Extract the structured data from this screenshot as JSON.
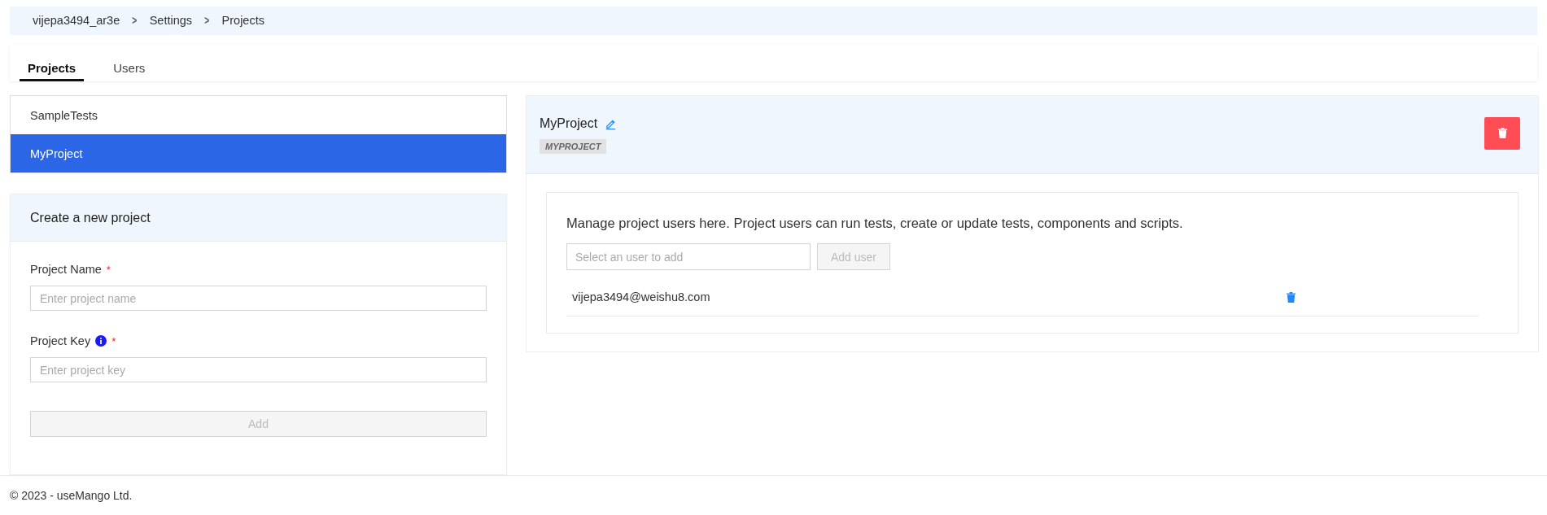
{
  "breadcrumb": [
    "vijepa3494_ar3e",
    "Settings",
    "Projects"
  ],
  "breadcrumb_separator": ">",
  "tabs": [
    {
      "label": "Projects",
      "selected": true
    },
    {
      "label": "Users",
      "selected": false
    }
  ],
  "projects": [
    {
      "name": "SampleTests",
      "selected": false
    },
    {
      "name": "MyProject",
      "selected": true
    }
  ],
  "create_form": {
    "title": "Create a new project",
    "fields": [
      {
        "label": "Project Name",
        "required": true,
        "info": false,
        "placeholder": "Enter project name"
      },
      {
        "label": "Project Key",
        "required": true,
        "info": true,
        "placeholder": "Enter project key"
      }
    ],
    "required_mark": "*",
    "submit": {
      "label": "Add",
      "disabled": true
    }
  },
  "project_detail": {
    "name": "MyProject",
    "key": "MYPROJECT",
    "description": "Manage project users here. Project users can run tests, create or update tests, components and scripts.",
    "user_select": {
      "placeholder": "Select an user to add"
    },
    "add_user": {
      "label": "Add user",
      "disabled": true
    },
    "users": [
      {
        "email": "vijepa3494@weishu8.com"
      }
    ]
  },
  "footer": "© 2023 - useMango Ltd."
}
